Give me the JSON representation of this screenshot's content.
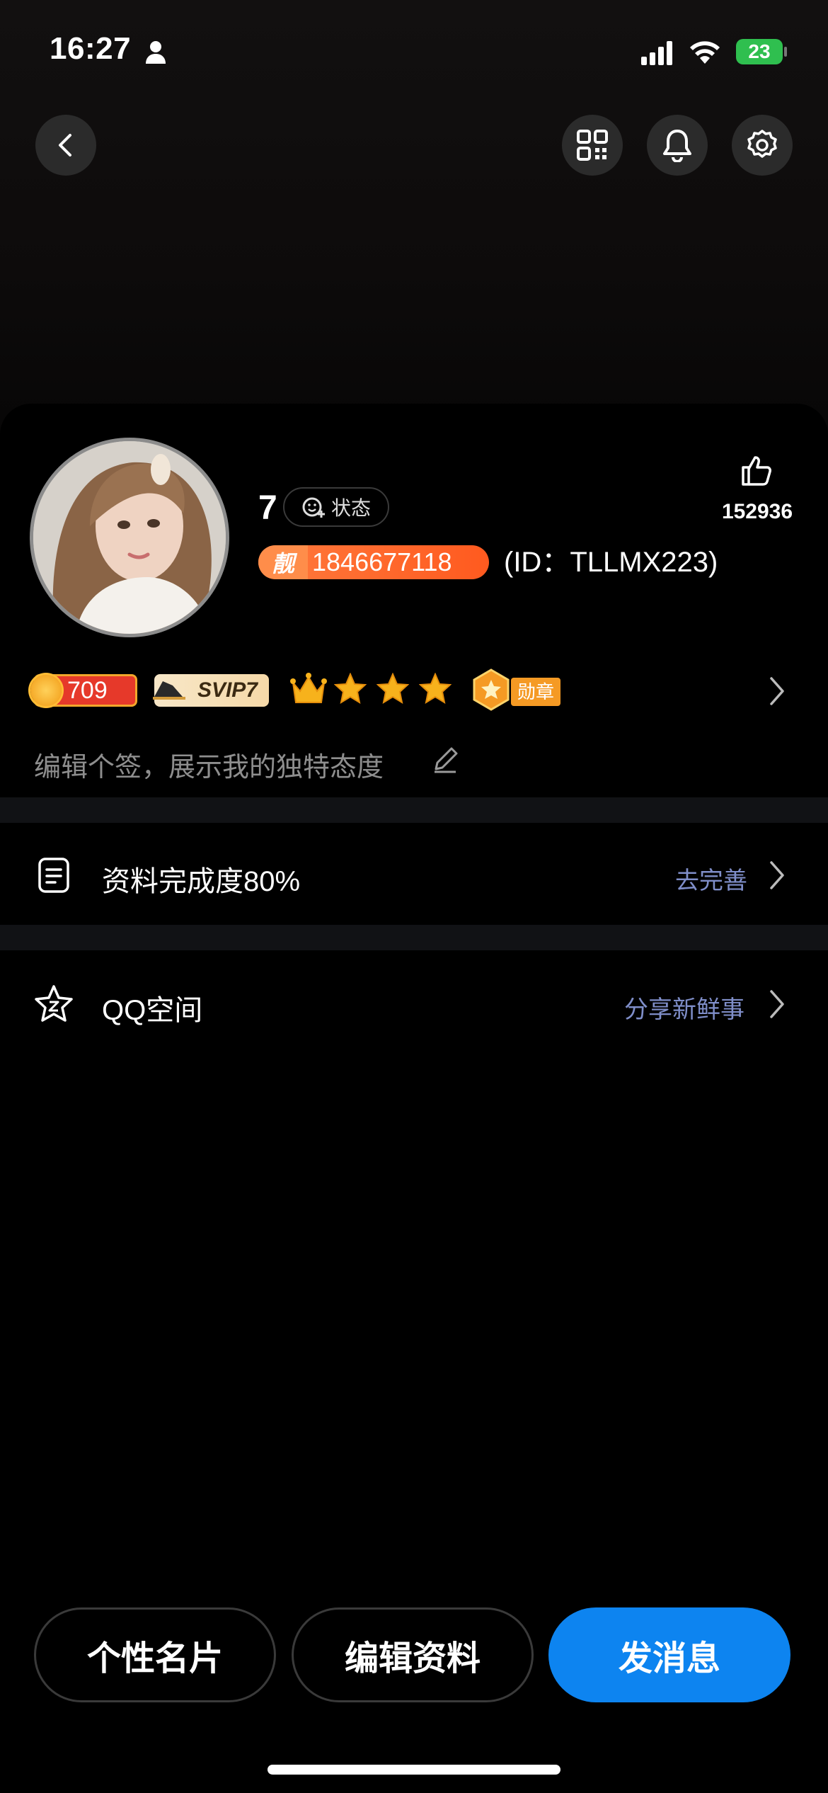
{
  "status_bar": {
    "time": "16:27",
    "battery": "23"
  },
  "header": {
    "back_icon": "chevron-left-icon",
    "actions": [
      "qr-code-icon",
      "bell-icon",
      "gear-icon"
    ]
  },
  "profile": {
    "nickname": "7",
    "status_label": "状态",
    "qq_prefix": "靓",
    "qq_number": "1846677118",
    "id_text": "(ID：TLLMX223)",
    "likes": "152936"
  },
  "badges": {
    "coin_value": "709",
    "svip": "SVIP7",
    "medal": "勋章"
  },
  "signature": "编辑个签，展示我的独特态度",
  "rows": {
    "completion": {
      "label": "资料完成度80%",
      "link": "去完善"
    },
    "qzone": {
      "label": "QQ空间",
      "link": "分享新鲜事"
    }
  },
  "buttons": {
    "card": "个性名片",
    "edit": "编辑资料",
    "message": "发消息"
  },
  "colors": {
    "accent": "#0d84f0",
    "link": "#7f8ec9",
    "qq_chip": "#ff5a1f"
  }
}
